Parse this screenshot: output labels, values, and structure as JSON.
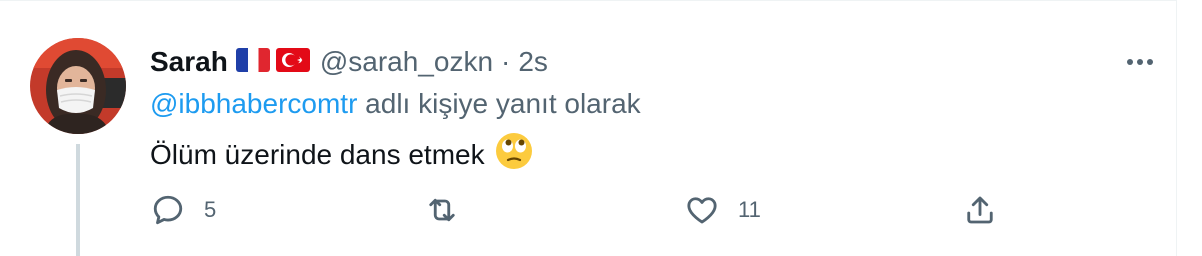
{
  "tweet": {
    "author_name": "Sarah",
    "author_handle": "@sarah_ozkn",
    "separator": "·",
    "time": "2s",
    "flags": [
      "france-flag",
      "turkey-flag"
    ],
    "reply_to_handle": "@ibbhabercomtr",
    "reply_suffix": " adlı kişiye yanıt olarak",
    "text": "Ölüm üzerinde dans etmek",
    "emoji": "face-with-rolling-eyes"
  },
  "actions": {
    "reply_count": "5",
    "retweet_count": "",
    "like_count": "11"
  },
  "colors": {
    "link": "#1d9bf0",
    "secondary_text": "#536471",
    "primary_text": "#0f1419",
    "thread_line": "#cfd9de"
  }
}
